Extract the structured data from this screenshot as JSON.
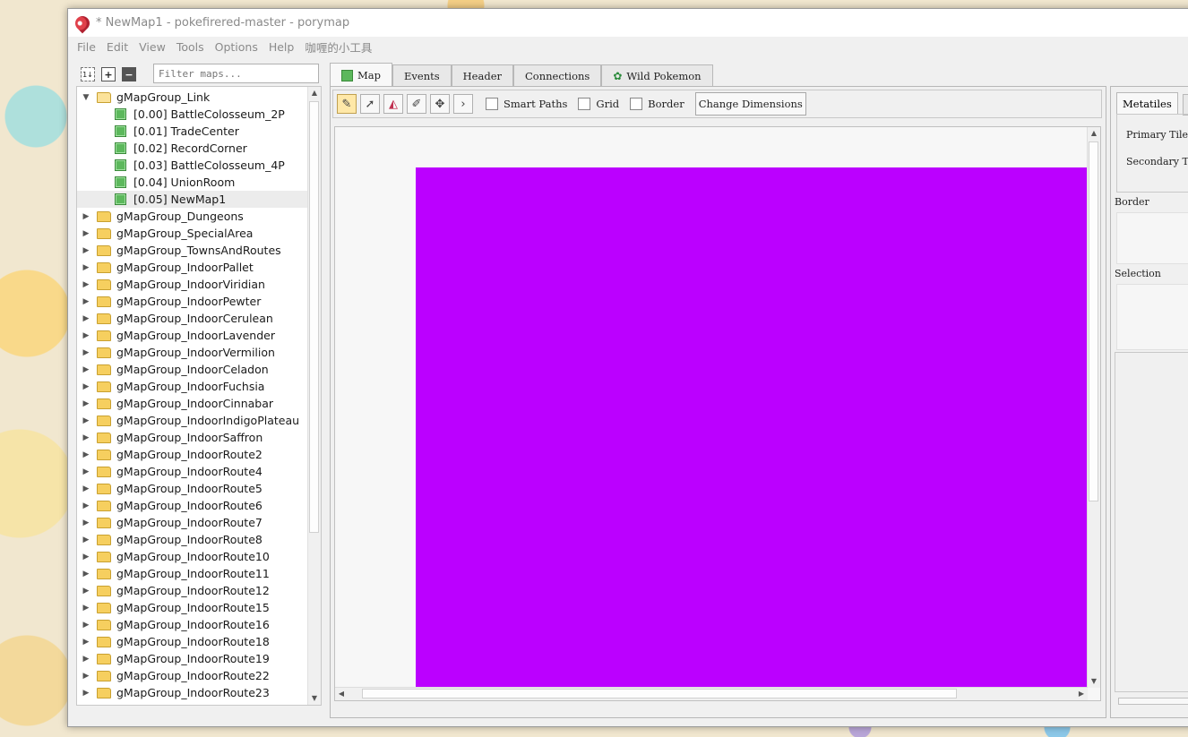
{
  "window": {
    "title": "* NewMap1 - pokefirered-master - porymap"
  },
  "menu": [
    "File",
    "Edit",
    "View",
    "Tools",
    "Options",
    "Help",
    "咖喱的小工具"
  ],
  "filter": {
    "placeholder": "Filter maps..."
  },
  "tree": {
    "expanded_group": "gMapGroup_Link",
    "maps": [
      "[0.00] BattleColosseum_2P",
      "[0.01] TradeCenter",
      "[0.02] RecordCorner",
      "[0.03] BattleColosseum_4P",
      "[0.04] UnionRoom",
      "[0.05] NewMap1"
    ],
    "selected_map_index": 5,
    "groups": [
      "gMapGroup_Dungeons",
      "gMapGroup_SpecialArea",
      "gMapGroup_TownsAndRoutes",
      "gMapGroup_IndoorPallet",
      "gMapGroup_IndoorViridian",
      "gMapGroup_IndoorPewter",
      "gMapGroup_IndoorCerulean",
      "gMapGroup_IndoorLavender",
      "gMapGroup_IndoorVermilion",
      "gMapGroup_IndoorCeladon",
      "gMapGroup_IndoorFuchsia",
      "gMapGroup_IndoorCinnabar",
      "gMapGroup_IndoorIndigoPlateau",
      "gMapGroup_IndoorSaffron",
      "gMapGroup_IndoorRoute2",
      "gMapGroup_IndoorRoute4",
      "gMapGroup_IndoorRoute5",
      "gMapGroup_IndoorRoute6",
      "gMapGroup_IndoorRoute7",
      "gMapGroup_IndoorRoute8",
      "gMapGroup_IndoorRoute10",
      "gMapGroup_IndoorRoute11",
      "gMapGroup_IndoorRoute12",
      "gMapGroup_IndoorRoute15",
      "gMapGroup_IndoorRoute16",
      "gMapGroup_IndoorRoute18",
      "gMapGroup_IndoorRoute19",
      "gMapGroup_IndoorRoute22",
      "gMapGroup_IndoorRoute23"
    ]
  },
  "tabs": {
    "map": "Map",
    "events": "Events",
    "header": "Header",
    "connections": "Connections",
    "wild": "Wild Pokemon"
  },
  "toolbar": {
    "smart_paths": "Smart Paths",
    "grid": "Grid",
    "border": "Border",
    "change_dimensions": "Change Dimensions"
  },
  "map_color": "#bb00ff",
  "right": {
    "tab": "Metatiles",
    "primary": "Primary Tile",
    "secondary": "Secondary Ti",
    "border": "Border",
    "selection": "Selection"
  }
}
